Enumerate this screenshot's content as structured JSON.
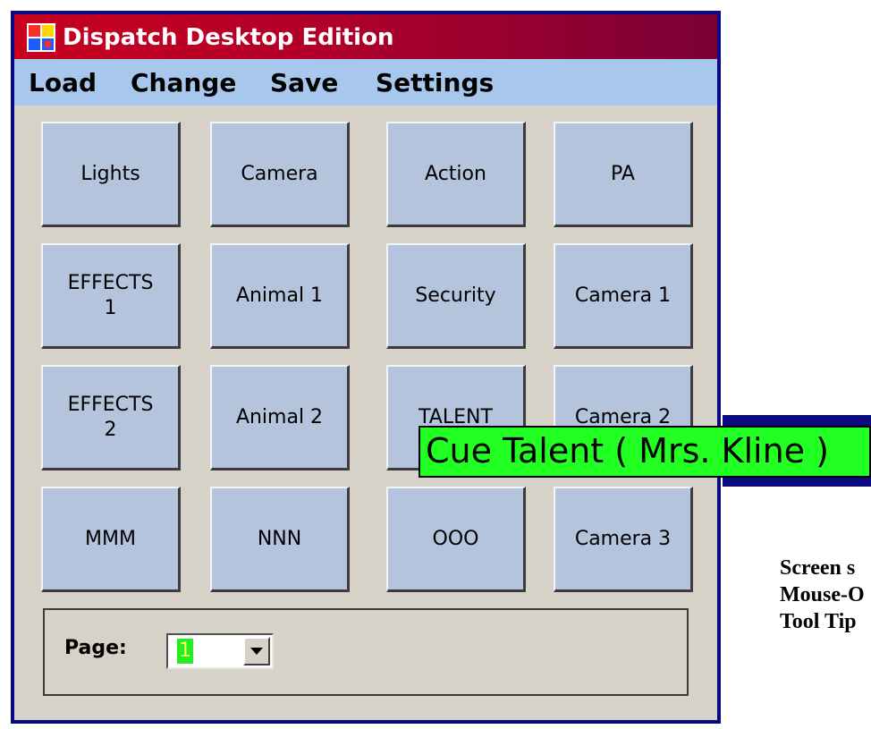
{
  "window": {
    "title": "Dispatch Desktop Edition",
    "app_icon": "app-grid-icon"
  },
  "menu": {
    "items": [
      "Load",
      "Change",
      "Save",
      "Settings"
    ]
  },
  "buttons": [
    [
      "Lights",
      "Camera",
      "Action",
      "PA"
    ],
    [
      "EFFECTS\n1",
      "Animal 1",
      "Security",
      "Camera 1"
    ],
    [
      "EFFECTS\n2",
      "Animal 2",
      "TALENT",
      "Camera 2"
    ],
    [
      "MMM",
      "NNN",
      "OOO",
      "Camera 3"
    ]
  ],
  "page": {
    "label": "Page:",
    "selected": "1"
  },
  "tooltip": {
    "text": "Cue Talent ( Mrs. Kline )"
  },
  "caption": {
    "lines": [
      "Screen s",
      "Mouse-O",
      "Tool Tip"
    ]
  },
  "colors": {
    "title_gradient_start": "#c8001e",
    "title_gradient_end": "#7a0036",
    "menubar": "#a7c8ec",
    "button_face": "#b4c4dc",
    "window_face": "#d6d2c8",
    "tooltip_bg": "#22ff22",
    "window_border": "#0a0a80"
  }
}
